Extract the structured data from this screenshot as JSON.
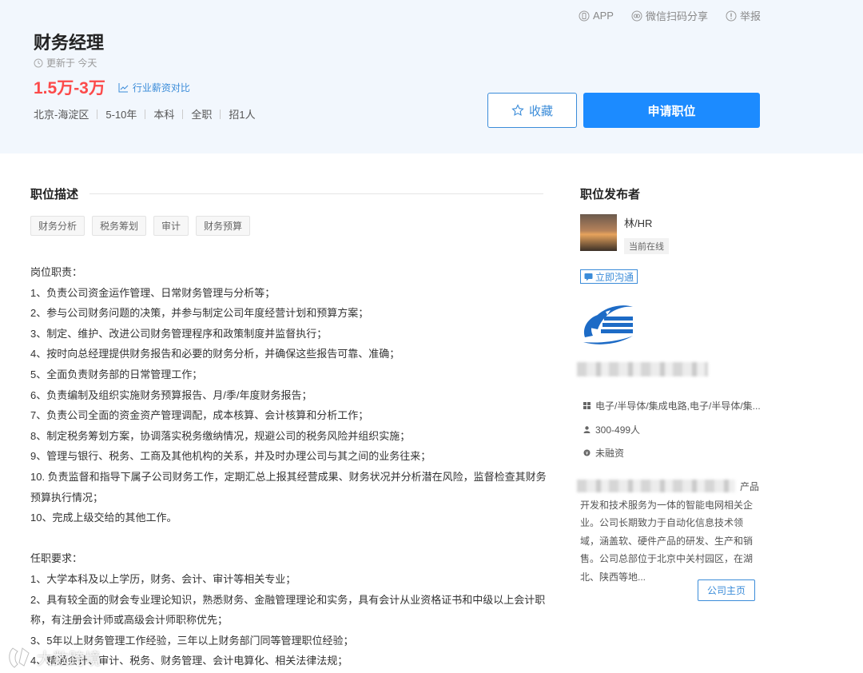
{
  "top_links": {
    "app": "APP",
    "share": "微信扫码分享",
    "report": "举报"
  },
  "job": {
    "title": "财务经理",
    "updated": "更新于 今天",
    "salary": "1.5万-3万",
    "compare": "行业薪资对比",
    "meta": [
      "北京-海淀区",
      "5-10年",
      "本科",
      "全职",
      "招1人"
    ]
  },
  "actions": {
    "collect": "收藏",
    "apply": "申请职位"
  },
  "description": {
    "title": "职位描述",
    "tags": [
      "财务分析",
      "税务筹划",
      "审计",
      "财务预算"
    ],
    "lines": [
      "岗位职责：",
      "1、负责公司资金运作管理、日常财务管理与分析等；",
      "2、参与公司财务问题的决策，并参与制定公司年度经营计划和预算方案；",
      "3、制定、维护、改进公司财务管理程序和政策制度并监督执行；",
      "4、按时向总经理提供财务报告和必要的财务分析，并确保这些报告可靠、准确；",
      "5、全面负责财务部的日常管理工作；",
      "6、负责编制及组织实施财务预算报告、月/季/年度财务报告；",
      "7、负责公司全面的资金资产管理调配，成本核算、会计核算和分析工作；",
      "8、制定税务筹划方案，协调落实税务缴纳情况，规避公司的税务风险并组织实施；",
      "9、管理与银行、税务、工商及其他机构的关系，并及时办理公司与其之间的业务往来；",
      "10. 负责监督和指导下属子公司财务工作，定期汇总上报其经营成果、财务状况并分析潜在风险，监督检查其财务",
      "预算执行情况；",
      "10、完成上级交给的其他工作。",
      "",
      "任职要求：",
      "1、大学本科及以上学历，财务、会计、审计等相关专业；",
      "2、具有较全面的财会专业理论知识，熟悉财务、金融管理理论和实务，具有会计从业资格证书和中级以上会计职",
      "称，有注册会计师或高级会计师职称优先；",
      "3、5年以上财务管理工作经验，三年以上财务部门同等管理职位经验；",
      "4、精通会计、审计、税务、财务管理、会计电算化、相关法律法规；"
    ]
  },
  "publisher": {
    "title": "职位发布者",
    "name": "林/HR",
    "status": "当前在线",
    "chat": "立即沟通"
  },
  "company": {
    "industry": "电子/半导体/集成电路,电子/半导体/集...",
    "size": "300-499人",
    "funding": "未融资",
    "intro_tail": "产品",
    "intro": "开发和技术服务为一体的智能电网相关企业。公司长期致力于自动化信息技术领域，涵盖软、硬件产品的研发、生产和销售。公司总部位于北京中关村园区，在湖北、陕西等地...",
    "home": "公司主页"
  },
  "watermark": "大数跨境",
  "colors": {
    "accent": "#1c8bff",
    "salary": "#fc4a4a",
    "link": "#3b8cd9",
    "header_bg": "#f2f7fd"
  }
}
